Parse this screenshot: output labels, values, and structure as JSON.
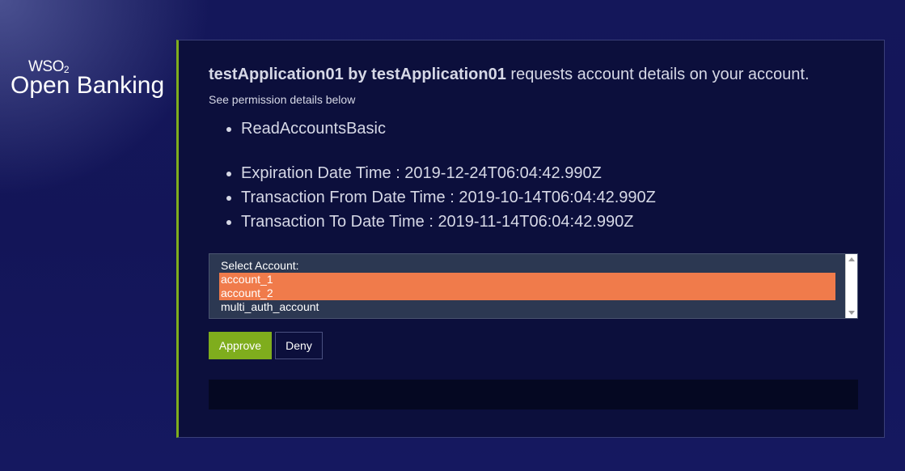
{
  "logo": {
    "top": "WSO",
    "sub": "2",
    "brand": "Open Banking"
  },
  "request": {
    "app_by": "testApplication01 by testApplication01",
    "text": " requests account details on your account.",
    "hint": "See permission details below"
  },
  "permissions": [
    "ReadAccountsBasic"
  ],
  "dates": [
    "Expiration Date Time : 2019-12-24T06:04:42.990Z",
    "Transaction From Date Time : 2019-10-14T06:04:42.990Z",
    "Transaction To Date Time : 2019-11-14T06:04:42.990Z"
  ],
  "account_select": {
    "label": "Select Account:",
    "options": [
      {
        "label": "account_1",
        "selected": true
      },
      {
        "label": "account_2",
        "selected": true
      },
      {
        "label": "multi_auth_account",
        "selected": false
      }
    ]
  },
  "buttons": {
    "approve": "Approve",
    "deny": "Deny"
  },
  "colors": {
    "accent": "#7fad1d",
    "selection": "#f07b4b",
    "background": "#14175a",
    "panel": "#0c0f3c"
  }
}
